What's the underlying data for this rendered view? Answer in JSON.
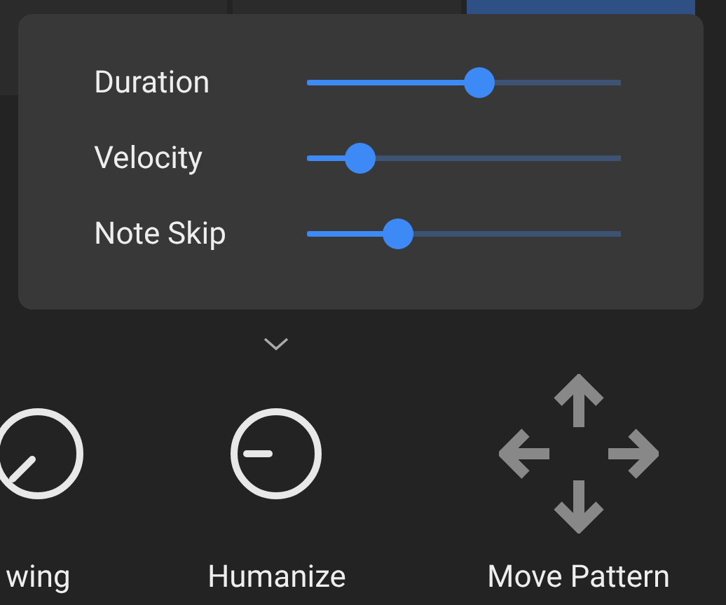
{
  "popup": {
    "sliders": [
      {
        "label": "Duration",
        "level": 0.55
      },
      {
        "label": "Velocity",
        "level": 0.17
      },
      {
        "label": "Note Skip",
        "level": 0.29
      }
    ]
  },
  "tools": [
    {
      "label": "wing",
      "kind": "knob",
      "expanded": false
    },
    {
      "label": "Humanize",
      "kind": "knob-minus",
      "expanded": true
    },
    {
      "label": "Move Pattern",
      "kind": "move",
      "expanded": false
    }
  ]
}
